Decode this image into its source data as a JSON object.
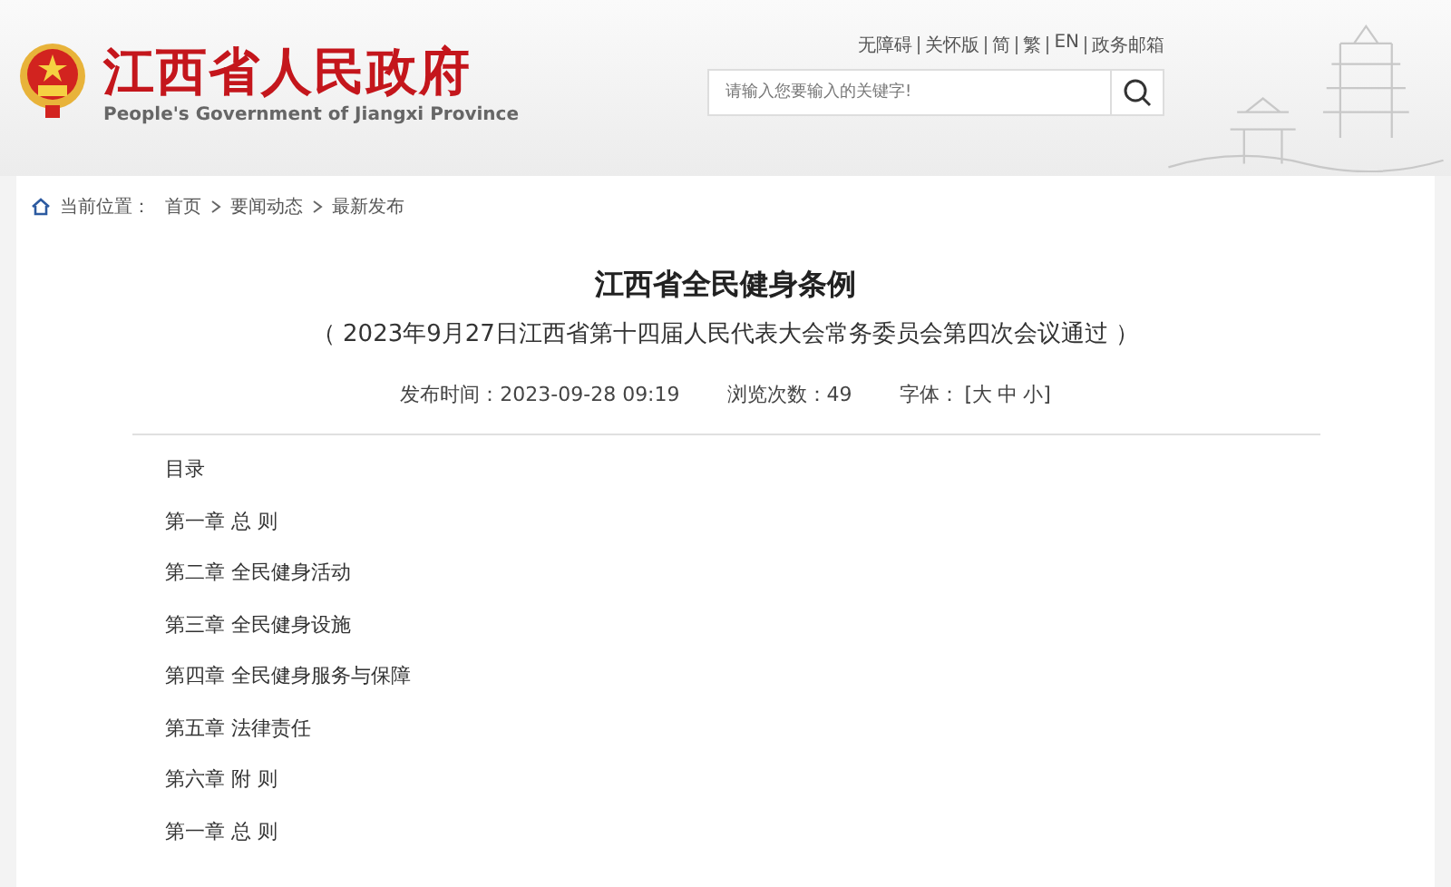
{
  "header": {
    "site_name": "江西省人民政府",
    "site_name_en": "People's Government of Jiangxi Province",
    "top_links": [
      {
        "label": "无障碍"
      },
      {
        "label": "关怀版"
      },
      {
        "label": "简"
      },
      {
        "label": "繁"
      },
      {
        "label": "EN"
      },
      {
        "label": "政务邮箱"
      }
    ],
    "search": {
      "placeholder": "请输入您要输入的关键字!"
    }
  },
  "breadcrumb": {
    "label": "当前位置：",
    "items": [
      "首页",
      "要闻动态",
      "最新发布"
    ]
  },
  "article": {
    "title": "江西省全民健身条例",
    "subtitle": "（ 2023年9月27日江西省第十四届人民代表大会常务委员会第四次会议通过 ）",
    "meta": {
      "published": "发布时间：2023-09-28 09:19",
      "views": "浏览次数：49",
      "font_label": "字体：",
      "font_sizes": [
        "[大",
        "中",
        "小]"
      ]
    },
    "paragraphs": [
      "目录",
      "第一章 总 则",
      "第二章 全民健身活动",
      "第三章 全民健身设施",
      "第四章 全民健身服务与保障",
      "第五章 法律责任",
      "第六章 附 则",
      "第一章 总 则"
    ]
  }
}
